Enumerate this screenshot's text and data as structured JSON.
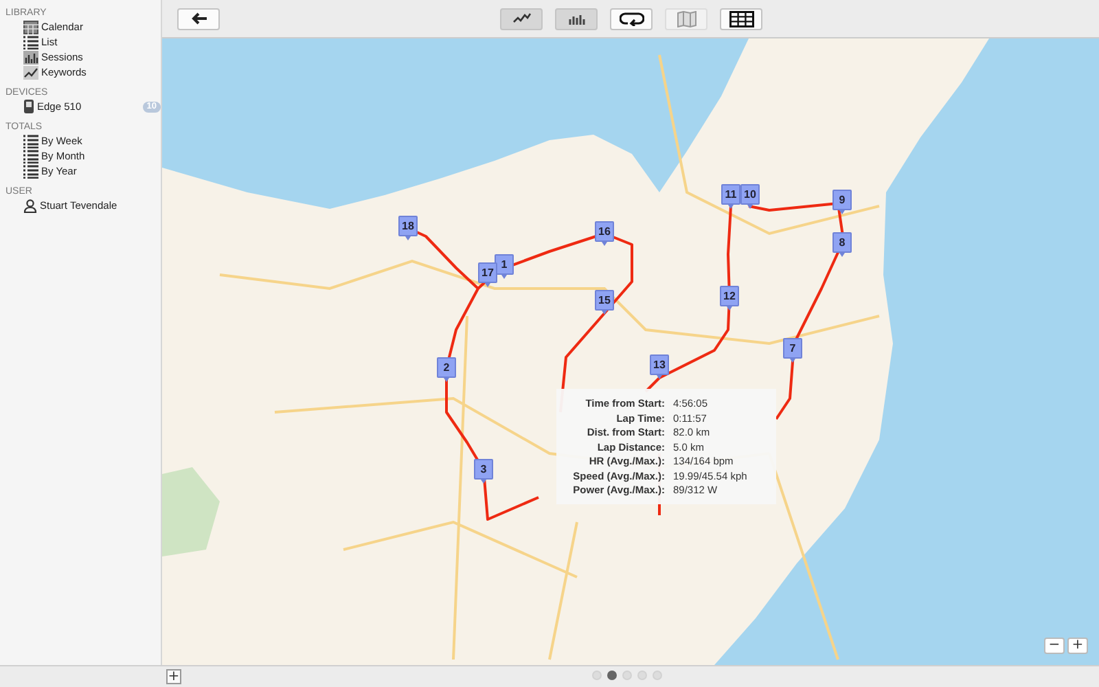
{
  "sidebar": {
    "sections": [
      {
        "heading": "LIBRARY",
        "items": [
          {
            "label": "Calendar",
            "kind": "calendar"
          },
          {
            "label": "List",
            "kind": "list"
          },
          {
            "label": "Sessions",
            "kind": "bars"
          },
          {
            "label": "Keywords",
            "kind": "keywords"
          }
        ]
      },
      {
        "heading": "DEVICES",
        "items": [
          {
            "label": "Edge 510",
            "kind": "device",
            "badge": "10"
          }
        ]
      },
      {
        "heading": "TOTALS",
        "items": [
          {
            "label": "By Week",
            "kind": "list"
          },
          {
            "label": "By Month",
            "kind": "list"
          },
          {
            "label": "By Year",
            "kind": "list"
          }
        ]
      },
      {
        "heading": "USER",
        "items": [
          {
            "label": "Stuart Tevendale",
            "kind": "user"
          }
        ]
      }
    ]
  },
  "toolbar": {
    "views": [
      {
        "kind": "line_chart",
        "selected": false,
        "disabled": true
      },
      {
        "kind": "bar_chart",
        "selected": false,
        "disabled": true
      },
      {
        "kind": "laps",
        "selected": false,
        "disabled": false
      },
      {
        "kind": "map",
        "selected": true,
        "disabled": false
      },
      {
        "kind": "table",
        "selected": false,
        "disabled": false
      }
    ]
  },
  "map": {
    "markers": [
      {
        "label": "1"
      },
      {
        "label": "18"
      },
      {
        "label": "17"
      },
      {
        "label": "16"
      },
      {
        "label": "15"
      },
      {
        "label": "2"
      },
      {
        "label": "3"
      },
      {
        "label": "13"
      },
      {
        "label": "12"
      },
      {
        "label": "11"
      },
      {
        "label": "10"
      },
      {
        "label": "9"
      },
      {
        "label": "8"
      },
      {
        "label": "7"
      }
    ],
    "tooltip": {
      "rows": [
        {
          "label": "Time from Start:",
          "value": "4:56:05"
        },
        {
          "label": "Lap Time:",
          "value": "0:11:57"
        },
        {
          "label": "Dist. from Start:",
          "value": "82.0 km"
        },
        {
          "label": "Lap Distance:",
          "value": "5.0 km"
        },
        {
          "label": "HR (Avg./Max.):",
          "value": "134/164 bpm"
        },
        {
          "label": "Speed (Avg./Max.):",
          "value": "19.99/45.54 kph"
        },
        {
          "label": "Power (Avg./Max.):",
          "value": "89/312 W"
        }
      ]
    },
    "zoom_controls": [
      "−",
      "+"
    ]
  },
  "bottom_bar": {
    "add_button": "+",
    "pages": [
      {
        "selected": false
      },
      {
        "selected": true
      },
      {
        "selected": false
      },
      {
        "selected": false
      },
      {
        "selected": false
      }
    ]
  }
}
